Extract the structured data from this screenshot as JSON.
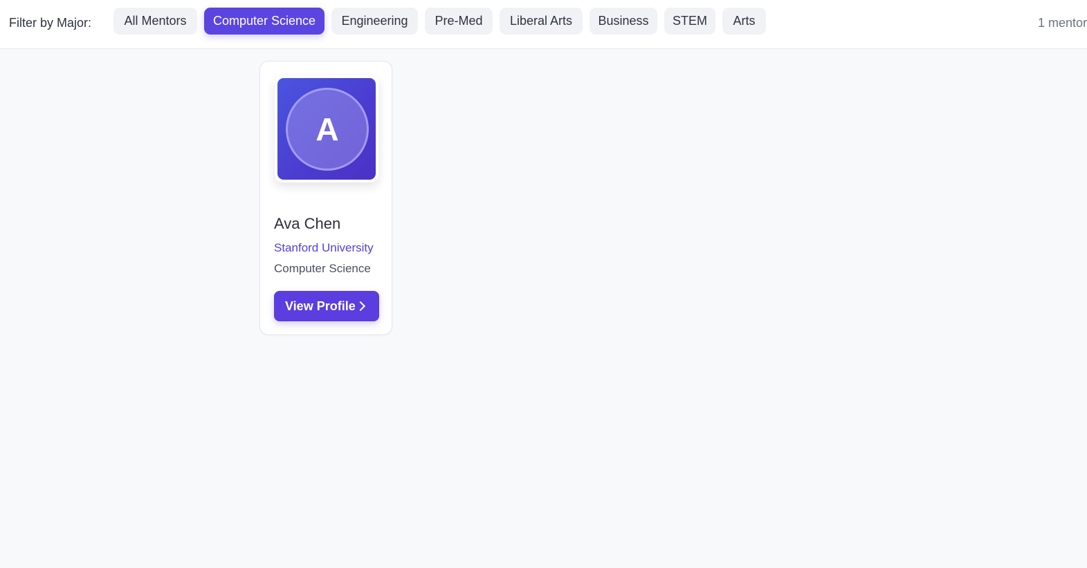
{
  "filter_bar": {
    "label": "Filter by Major:",
    "chips": [
      {
        "label": "All Mentors",
        "active": false
      },
      {
        "label": "Computer Science",
        "active": true
      },
      {
        "label": "Engineering",
        "active": false
      },
      {
        "label": "Pre-Med",
        "active": false
      },
      {
        "label": "Liberal Arts",
        "active": false
      },
      {
        "label": "Business",
        "active": false
      },
      {
        "label": "STEM",
        "active": false
      },
      {
        "label": "Arts",
        "active": false
      }
    ],
    "count_text": "1 mentor"
  },
  "mentors": [
    {
      "initial": "A",
      "name": "Ava Chen",
      "school": "Stanford University",
      "major": "Computer Science",
      "button_label": "View Profile"
    }
  ],
  "colors": {
    "accent": "#5b45e0",
    "school_text": "#5540d9",
    "chip_bg": "#f1f2f5",
    "page_bg": "#f8f9fb"
  },
  "icons": {
    "button_icon": "chevron-right-icon"
  }
}
